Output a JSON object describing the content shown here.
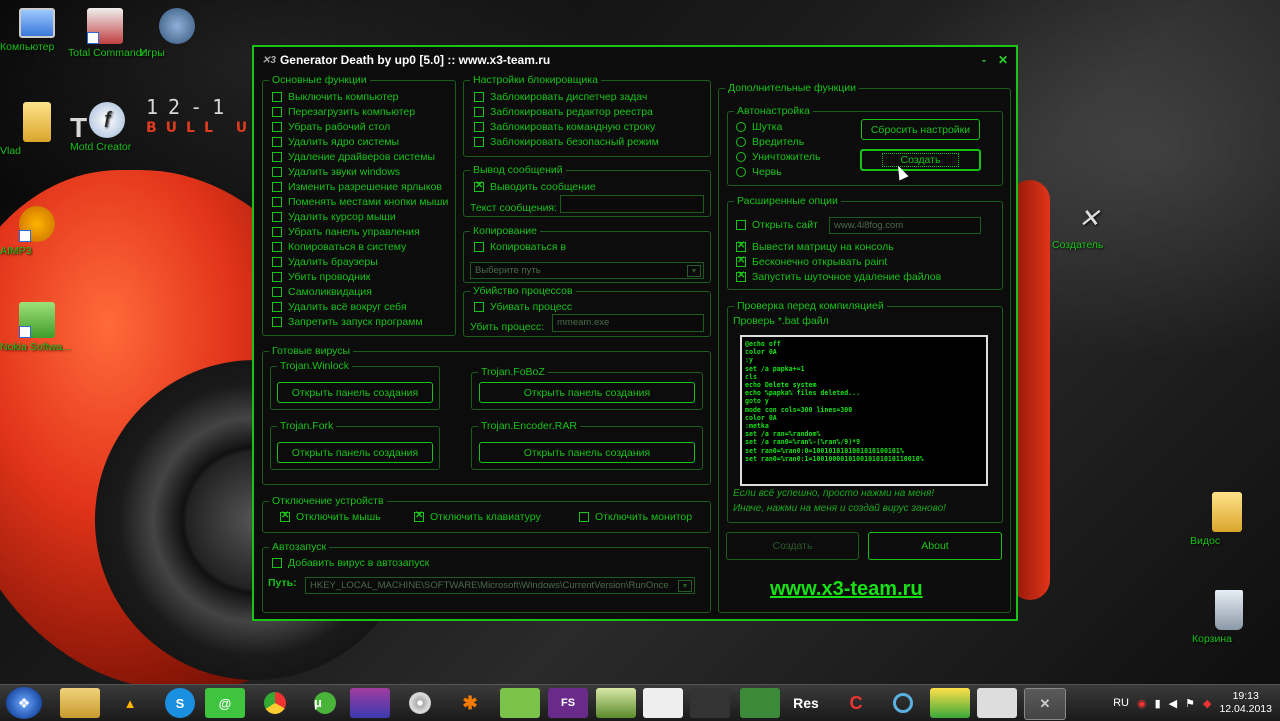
{
  "desktop": {
    "icons": [
      {
        "label": "Компьютер",
        "key": "computer"
      },
      {
        "label": "Total Commander",
        "key": "total-commander"
      },
      {
        "label": "Игры",
        "key": "games"
      },
      {
        "label": "Vlad",
        "key": "vlad"
      },
      {
        "label": "Motd Creator",
        "key": "motd-creator"
      },
      {
        "label": "AIMP3",
        "key": "aimp3"
      },
      {
        "label": "Nokia Softwa...",
        "key": "nokia-software"
      },
      {
        "label": "Создатель",
        "key": "creator"
      },
      {
        "label": "Видос",
        "key": "video-folder"
      },
      {
        "label": "Корзина",
        "key": "recycle-bin"
      }
    ],
    "wallpaper_text": {
      "line1": "12-1",
      "line2": "BULL U",
      "t": "T"
    }
  },
  "window": {
    "title": "Generator Death by up0 [5.0] :: www.x3-team.ru",
    "minimize": "-",
    "close": "✕",
    "basic": {
      "title": "Основные функции",
      "items": [
        {
          "label": "Выключить компьютер",
          "checked": false
        },
        {
          "label": "Перезагрузить компьютер",
          "checked": false
        },
        {
          "label": "Убрать рабочий стол",
          "checked": false
        },
        {
          "label": "Удалить ядро системы",
          "checked": false
        },
        {
          "label": "Удаление драйверов системы",
          "checked": false
        },
        {
          "label": "Удалить звуки windows",
          "checked": false
        },
        {
          "label": "Изменить разрешение ярлыков",
          "checked": false
        },
        {
          "label": "Поменять местами кнопки мыши",
          "checked": false
        },
        {
          "label": "Удалить курсор мыши",
          "checked": false
        },
        {
          "label": "Убрать панель управления",
          "checked": false
        },
        {
          "label": "Копироваться в систему",
          "checked": false
        },
        {
          "label": "Удалить браузеры",
          "checked": false
        },
        {
          "label": "Убить проводник",
          "checked": false
        },
        {
          "label": "Самоликвидация",
          "checked": false
        },
        {
          "label": "Удалить всё вокруг себя",
          "checked": false
        },
        {
          "label": "Запретить запуск программ",
          "checked": false
        }
      ]
    },
    "blocker": {
      "title": "Настройки блокировщика",
      "items": [
        {
          "label": "Заблокировать диспетчер задач",
          "checked": false
        },
        {
          "label": "Заблокировать редактор реестра",
          "checked": false
        },
        {
          "label": "Заблокировать командную строку",
          "checked": false
        },
        {
          "label": "Заблокировать безопасный режим",
          "checked": false
        }
      ]
    },
    "message": {
      "title": "Вывод сообщений",
      "checkbox": "Выводить сообщение",
      "checked": true,
      "text_label": "Текст сообщения:",
      "text_value": ""
    },
    "copy": {
      "title": "Копирование",
      "checkbox": "Копироваться в",
      "checked": false,
      "select_value": "Выберите путь"
    },
    "kill": {
      "title": "Убийство процессов",
      "checkbox": "Убивать процесс",
      "checked": false,
      "label": "Убить процесс:",
      "value": "mmeam.exe"
    },
    "ready": {
      "title": "Готовые вирусы",
      "viruses": [
        {
          "name": "Trojan.Winlock",
          "button": "Открыть панель создания"
        },
        {
          "name": "Trojan.FoBoZ",
          "button": "Открыть панель создания"
        },
        {
          "name": "Trojan.Fork",
          "button": "Открыть панель создания"
        },
        {
          "name": "Trojan.Encoder.RAR",
          "button": "Открыть панель создания"
        }
      ]
    },
    "devices": {
      "title": "Отключение устройств",
      "items": [
        {
          "label": "Отключить мышь",
          "checked": true
        },
        {
          "label": "Отключить клавиатуру",
          "checked": true
        },
        {
          "label": "Отключить монитор",
          "checked": false
        }
      ]
    },
    "autorun": {
      "title": "Автозапуск",
      "checkbox": "Добавить вирус в автозапуск",
      "checked": false,
      "path_label": "Путь:",
      "path_value": "HKEY_LOCAL_MACHINE\\SOFTWARE\\Microsoft\\Windows\\CurrentVersion\\RunOnce"
    },
    "extra": {
      "title": "Дополнительные функции",
      "auto": {
        "title": "Автонастройка",
        "radios": [
          "Шутка",
          "Вредитель",
          "Уничтожитель",
          "Червь"
        ],
        "reset_button": "Сбросить настройки",
        "create_button": "Создать"
      },
      "advanced": {
        "title": "Расширенные опции",
        "items": [
          {
            "label": "Открыть сайт",
            "checked": false
          },
          {
            "label": "Вывести матрицу на консоль",
            "checked": true
          },
          {
            "label": "Бесконечно открывать paint",
            "checked": true
          },
          {
            "label": "Запустить шуточное удаление файлов",
            "checked": true
          }
        ],
        "site_value": "www.4i8fog.com"
      },
      "check": {
        "title": "Проверка перед компиляцией",
        "label": "Проверь *.bat файл",
        "console": [
          "@echo off",
          "color 0A",
          ":y",
          "set /a papka+=1",
          "cls",
          "echo Delete system",
          "echo %papka% files deleted...",
          "goto y",
          "mode con cols=300 lines=300",
          "color 0A",
          ":metka",
          "set /a ran=%random%",
          "set /a ran0=%ran%-(%ran%/9)*9",
          "set ran0=%ran0:0=1001010101001010100101%",
          "set ran0=%ran0:1=100100001010010101010110010%"
        ],
        "note1": "Если всё успешно, просто нажми на меня!",
        "note2": "Иначе, нажми на меня и создай вирус заново!"
      },
      "create_button": "Создать",
      "about_button": "About",
      "site_link": "www.x3-team.ru"
    }
  },
  "taskbar": {
    "lang": "RU",
    "time": "19:13",
    "date": "12.04.2013",
    "res_label": "Res",
    "fs_label": "FS"
  }
}
